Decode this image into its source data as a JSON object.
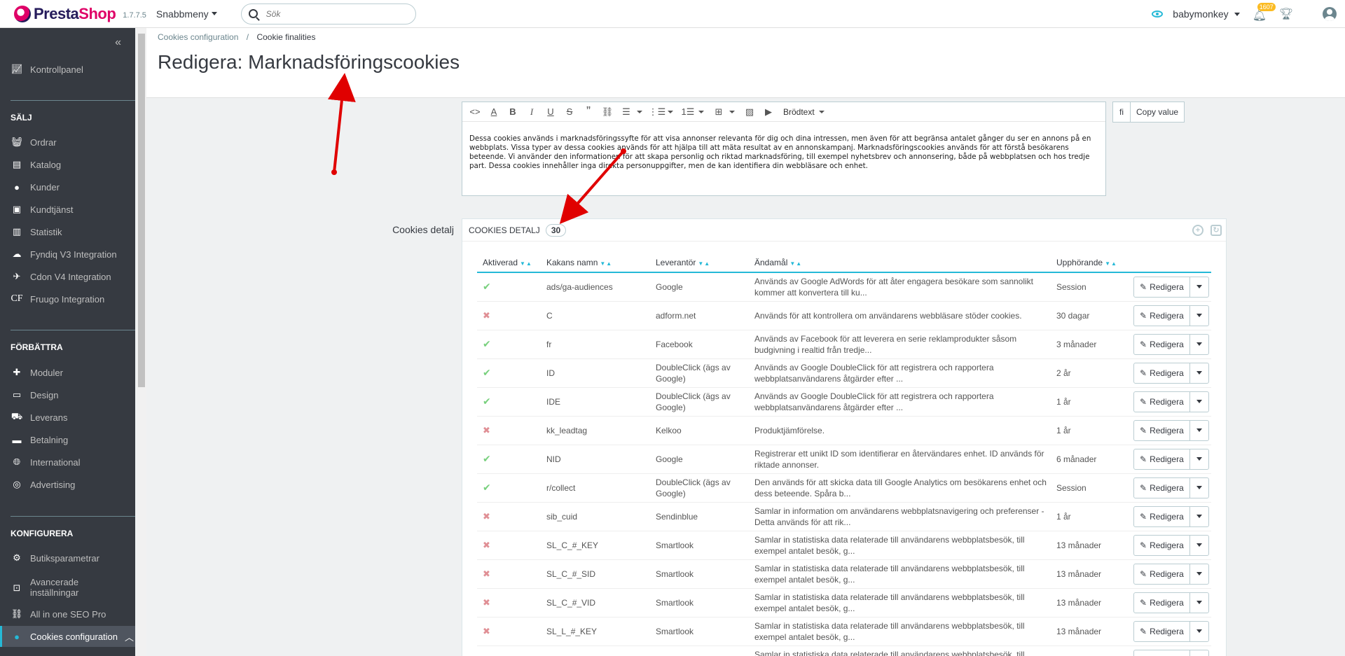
{
  "header": {
    "logo_prefix": "Presta",
    "logo_suffix": "Shop",
    "version": "1.7.7.5",
    "quick_access": "Snabbmeny",
    "search_placeholder": "Sök",
    "shop_name": "babymonkey",
    "notifications_count": "1607"
  },
  "sidebar": {
    "dashboard": "Kontrollpanel",
    "sections": [
      {
        "title": "SÄLJ",
        "items": [
          "Ordrar",
          "Katalog",
          "Kunder",
          "Kundtjänst",
          "Statistik",
          "Fyndiq V3 Integration",
          "Cdon V4 Integration",
          "Fruugo Integration"
        ]
      },
      {
        "title": "FÖRBÄTTRA",
        "items": [
          "Moduler",
          "Design",
          "Leverans",
          "Betalning",
          "International",
          "Advertising"
        ]
      },
      {
        "title": "KONFIGURERA",
        "items": [
          "Butiksparametrar",
          "Avancerade inställningar",
          "All in one SEO Pro",
          "Cookies configuration"
        ]
      }
    ],
    "fruugo_badge": "CF"
  },
  "breadcrumb": {
    "parent": "Cookies configuration",
    "separator": "/",
    "current": "Cookie finalities"
  },
  "page_title": "Redigera: Marknadsföringscookies",
  "editor": {
    "format_label": "Brödtext",
    "content": "Dessa cookies används i marknadsföringssyfte för att visa annonser relevanta för dig och dina intressen, men även för att begränsa antalet gånger du ser en annons på en webbplats. Vissa typer av dessa cookies används för att hjälpa till att mäta resultat av en annonskampanj. Marknadsföringscookies används för att förstå besökarens beteende. Vi använder den informationen för att skapa personlig och riktad marknadsföring, till exempel nyhetsbrev och annonsering, både på webbplatsen och hos tredje part. Dessa cookies innehåller inga direkta personuppgifter, men de kan identifiera din webbläsare och enhet.",
    "lang": "fi",
    "copy_value": "Copy value"
  },
  "cookies_detail": {
    "label": "Cookies detalj",
    "panel_title": "COOKIES DETALJ",
    "count": "30",
    "columns": [
      "Aktiverad",
      "Kakans namn",
      "Leverantör",
      "Ändamål",
      "Upphörande"
    ],
    "edit_label": "Redigera",
    "rows": [
      {
        "active": true,
        "name": "ads/ga-audiences",
        "provider": "Google",
        "purpose": "Används av Google AdWords för att åter engagera besökare som sannolikt kommer att konvertera till ku...",
        "expiry": "Session"
      },
      {
        "active": false,
        "name": "C",
        "provider": "adform.net",
        "purpose": "Används för att kontrollera om användarens webbläsare stöder cookies.",
        "expiry": "30 dagar"
      },
      {
        "active": true,
        "name": "fr",
        "provider": "Facebook",
        "purpose": "Används av Facebook för att leverera en serie reklamprodukter såsom budgivning i realtid från tredje...",
        "expiry": "3 månader"
      },
      {
        "active": true,
        "name": "ID",
        "provider": "DoubleClick (ägs av Google)",
        "purpose": "Används av Google DoubleClick för att registrera och rapportera webbplatsanvändarens åtgärder efter ...",
        "expiry": "2 år"
      },
      {
        "active": true,
        "name": "IDE",
        "provider": "DoubleClick (ägs av Google)",
        "purpose": "Används av Google DoubleClick för att registrera och rapportera webbplatsanvändarens åtgärder efter ...",
        "expiry": "1 år"
      },
      {
        "active": false,
        "name": "kk_leadtag",
        "provider": "Kelkoo",
        "purpose": "Produktjämförelse.",
        "expiry": "1 år"
      },
      {
        "active": true,
        "name": "NID",
        "provider": "Google",
        "purpose": "Registrerar ett unikt ID som identifierar en återvändares enhet. ID används för riktade annonser.",
        "expiry": "6 månader"
      },
      {
        "active": true,
        "name": "r/collect",
        "provider": "DoubleClick (ägs av Google)",
        "purpose": "Den används för att skicka data till Google Analytics om besökarens enhet och dess beteende. Spåra b...",
        "expiry": "Session"
      },
      {
        "active": false,
        "name": "sib_cuid",
        "provider": "Sendinblue",
        "purpose": "Samlar in information om användarens webbplatsnavigering och preferenser - Detta används för att rik...",
        "expiry": "1 år"
      },
      {
        "active": false,
        "name": "SL_C_#_KEY",
        "provider": "Smartlook",
        "purpose": "Samlar in statistiska data relaterade till användarens webbplatsbesök, till exempel antalet besök, g...",
        "expiry": "13 månader"
      },
      {
        "active": false,
        "name": "SL_C_#_SID",
        "provider": "Smartlook",
        "purpose": "Samlar in statistiska data relaterade till användarens webbplatsbesök, till exempel antalet besök, g...",
        "expiry": "13 månader"
      },
      {
        "active": false,
        "name": "SL_C_#_VID",
        "provider": "Smartlook",
        "purpose": "Samlar in statistiska data relaterade till användarens webbplatsbesök, till exempel antalet besök, g...",
        "expiry": "13 månader"
      },
      {
        "active": false,
        "name": "SL_L_#_KEY",
        "provider": "Smartlook",
        "purpose": "Samlar in statistiska data relaterade till användarens webbplatsbesök, till exempel antalet besök, g...",
        "expiry": "13 månader"
      },
      {
        "active": false,
        "name": "",
        "provider": "",
        "purpose": "Samlar in statistiska data relaterade till användarens webbplatsbesök, till exempel antalet besök, g...",
        "expiry": ""
      }
    ]
  },
  "colors": {
    "accent": "#25b9d7",
    "sidebar_bg": "#363a41",
    "annotation_arrow": "#e00000"
  }
}
